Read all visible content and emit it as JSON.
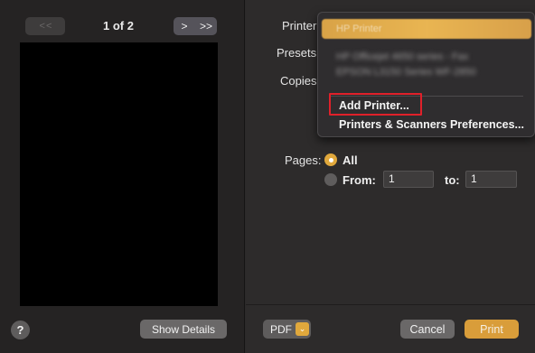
{
  "preview": {
    "page_indicator": "1 of 2",
    "nav_back_glyph": "< <",
    "nav_next_glyph": ">",
    "nav_last_glyph": ">>",
    "help_label": "?",
    "show_details_label": "Show Details"
  },
  "settings": {
    "printer_label": "Printer",
    "presets_label": "Presets",
    "copies_label": "Copies",
    "pages_label": "Pages:",
    "pages_all_label": "All",
    "pages_from_label": "From:",
    "pages_from_value": "1",
    "pages_to_label": "to:",
    "pages_to_value": "1",
    "pages_selected": "All"
  },
  "printer_menu": {
    "selected_item": "HP Printer",
    "blurred_items": [
      "HP Officejet 4650 series - Fax",
      "EPSON L3150 Series WF-2850"
    ],
    "add_printer_label": "Add Printer...",
    "preferences_label": "Printers & Scanners Preferences..."
  },
  "footer": {
    "pdf_label": "PDF",
    "pdf_chevron": "⌄",
    "cancel_label": "Cancel",
    "print_label": "Print"
  },
  "colors": {
    "accent": "#e0a83c",
    "highlight_box": "#e0202a",
    "background": "#2b2929"
  },
  "icons": {
    "help": "question-mark-icon",
    "nav_next": "chevron-right-icon",
    "nav_last": "double-chevron-right-icon",
    "pdf_menu": "chevron-down-icon"
  }
}
